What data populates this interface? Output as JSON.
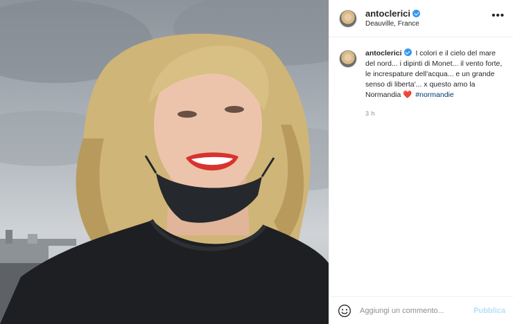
{
  "post": {
    "username": "antoclerici",
    "verified": true,
    "location": "Deauville, France",
    "image_subject": "selfie-photo",
    "caption": {
      "username": "antoclerici",
      "text": "I colori e il cielo del mare del nord... i dipinti di Monet... il vento forte, le increspature dell'acqua... e un grande senso di liberta'... x questo amo la Normandia",
      "heart": "❤️",
      "hashtag": "#normandie"
    },
    "time_ago": "3 h"
  },
  "comment_bar": {
    "placeholder": "Aggiungi un commento...",
    "publish_label": "Pubblica"
  },
  "icons": {
    "more": "more-options-icon",
    "emoji": "emoji-icon",
    "verified": "verified-badge-icon"
  },
  "colors": {
    "verified_blue": "#3897f0",
    "hashtag": "#00376b",
    "publish_disabled": "#b2dffc",
    "heart": "#ed4956"
  }
}
